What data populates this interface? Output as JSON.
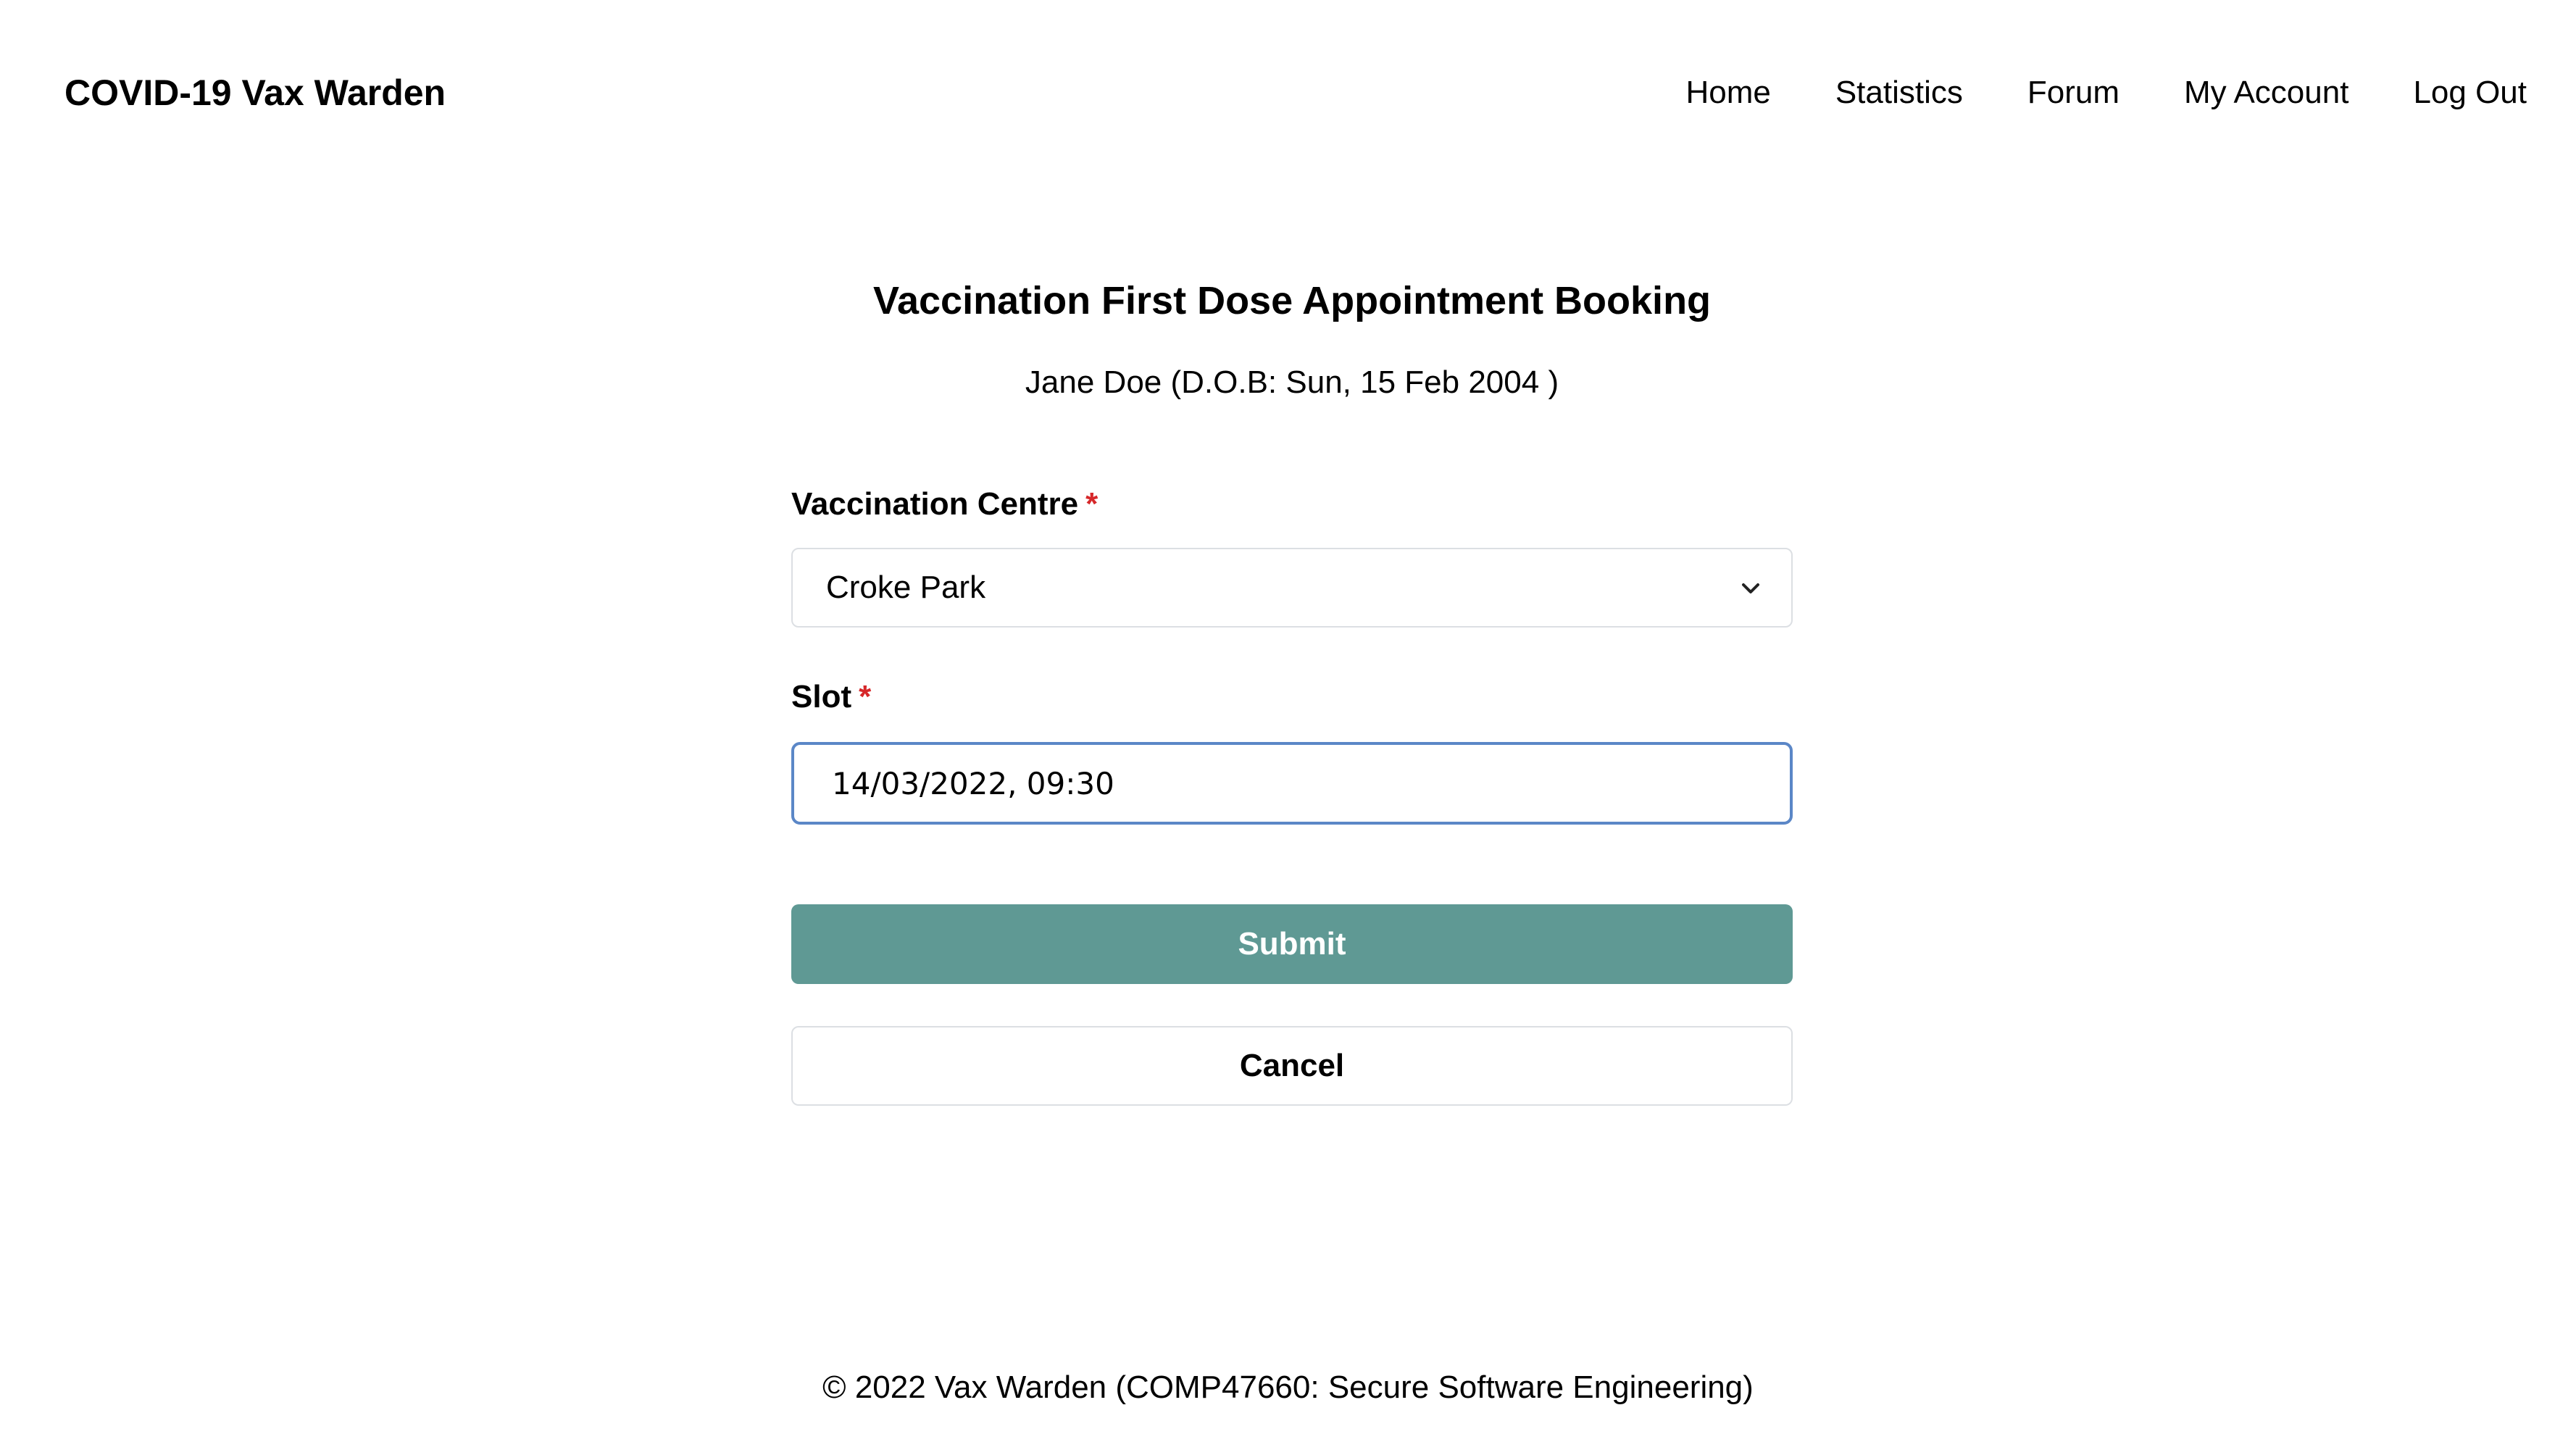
{
  "header": {
    "brand": "COVID-19 Vax Warden",
    "nav": [
      {
        "label": "Home"
      },
      {
        "label": "Statistics"
      },
      {
        "label": "Forum"
      },
      {
        "label": "My Account"
      },
      {
        "label": "Log Out"
      }
    ]
  },
  "main": {
    "title": "Vaccination First Dose Appointment Booking",
    "subtitle": "Jane Doe (D.O.B: Sun, 15 Feb 2004 )",
    "centre": {
      "label": "Vaccination Centre",
      "required_mark": "*",
      "selected": "Croke Park",
      "icon": "chevron-down-icon"
    },
    "slot": {
      "label": "Slot",
      "required_mark": "*",
      "value": "14/03/2022, 09:30"
    },
    "submit_label": "Submit",
    "cancel_label": "Cancel"
  },
  "footer": {
    "text": "© 2022 Vax Warden (COMP47660: Secure Software Engineering)"
  },
  "colors": {
    "accent": "#5f9994",
    "required": "#d6282a",
    "focus_border": "#5b87c7"
  }
}
